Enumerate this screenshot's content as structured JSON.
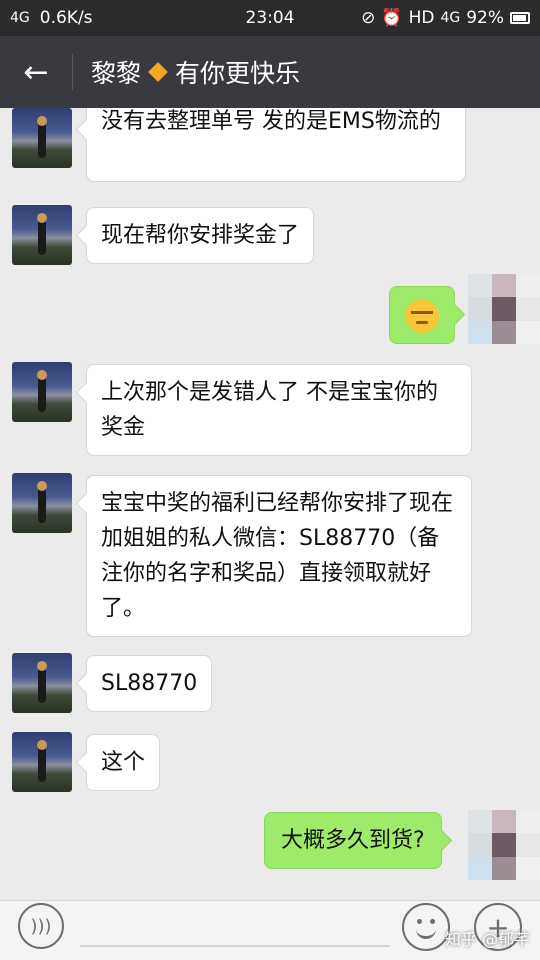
{
  "statusbar": {
    "network": "4G",
    "speed": "0.6K/s",
    "time": "23:04",
    "hd": "HD",
    "network_right": "4G",
    "battery": "92%"
  },
  "header": {
    "back_icon": "arrow-left-icon",
    "title_part1": "黎黎",
    "title_part2": "有你更快乐"
  },
  "messages": [
    {
      "side": "left",
      "text": "没有去整理单号  发的是EMS物流的"
    },
    {
      "side": "left",
      "text": "现在帮你安排奖金了"
    },
    {
      "side": "right",
      "emoji": "smirk-face-icon"
    },
    {
      "side": "left",
      "text": "上次那个是发错人了 不是宝宝你的奖金"
    },
    {
      "side": "left",
      "text": "宝宝中奖的福利已经帮你安排了现在加姐姐的私人微信：SL88770（备注你的名字和奖品）直接领取就好了。"
    },
    {
      "side": "left",
      "text": "SL88770"
    },
    {
      "side": "left",
      "text": "这个"
    },
    {
      "side": "right",
      "text": "大概多久到货?"
    }
  ],
  "inputbar": {
    "voice_icon": "voice-icon",
    "emoji_icon": "emoji-icon",
    "plus_icon": "plus-icon"
  },
  "watermark": "知乎 @郁芊"
}
